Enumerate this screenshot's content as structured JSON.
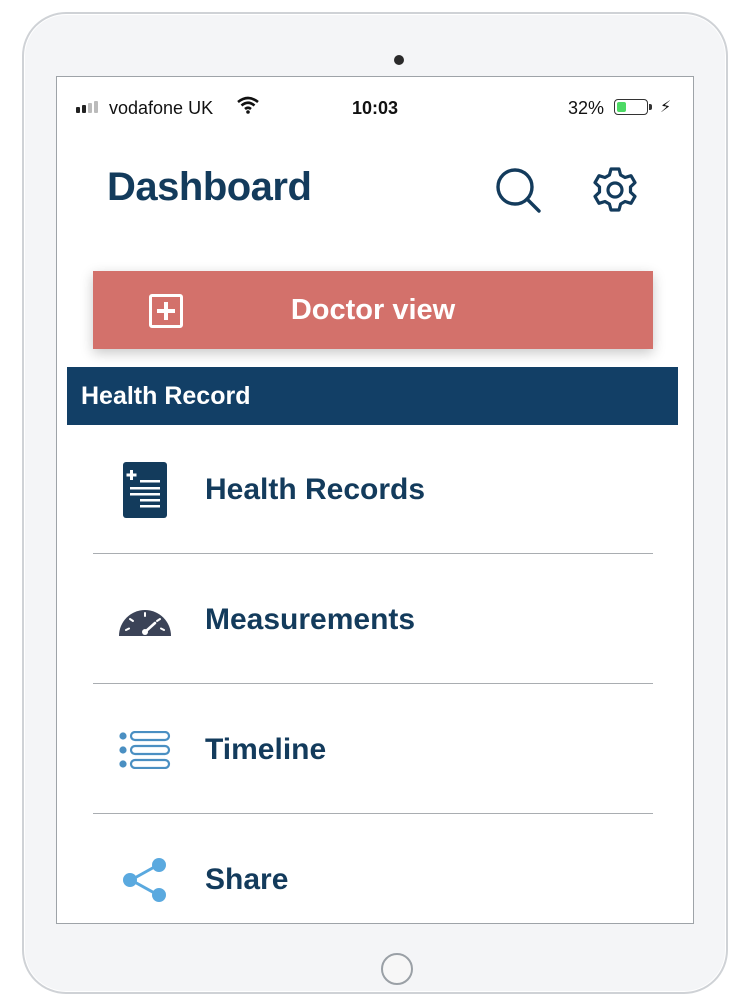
{
  "status_bar": {
    "carrier": "vodafone UK",
    "time": "10:03",
    "battery_percent": "32%",
    "battery_level": 0.32,
    "charging": true
  },
  "header": {
    "title": "Dashboard",
    "search_icon": "search-icon",
    "settings_icon": "gear-icon"
  },
  "doctor_view": {
    "label": "Doctor view",
    "icon": "plus-square-icon",
    "color": "#d3716b"
  },
  "section": {
    "title": "Health Record",
    "color": "#123f66"
  },
  "menu": {
    "items": [
      {
        "label": "Health Records",
        "icon": "health-record-document-icon"
      },
      {
        "label": "Measurements",
        "icon": "gauge-icon"
      },
      {
        "label": "Timeline",
        "icon": "list-icon"
      },
      {
        "label": "Share",
        "icon": "share-icon"
      }
    ]
  },
  "colors": {
    "primary_text": "#133b5c",
    "accent_light_blue": "#5aa9df"
  }
}
